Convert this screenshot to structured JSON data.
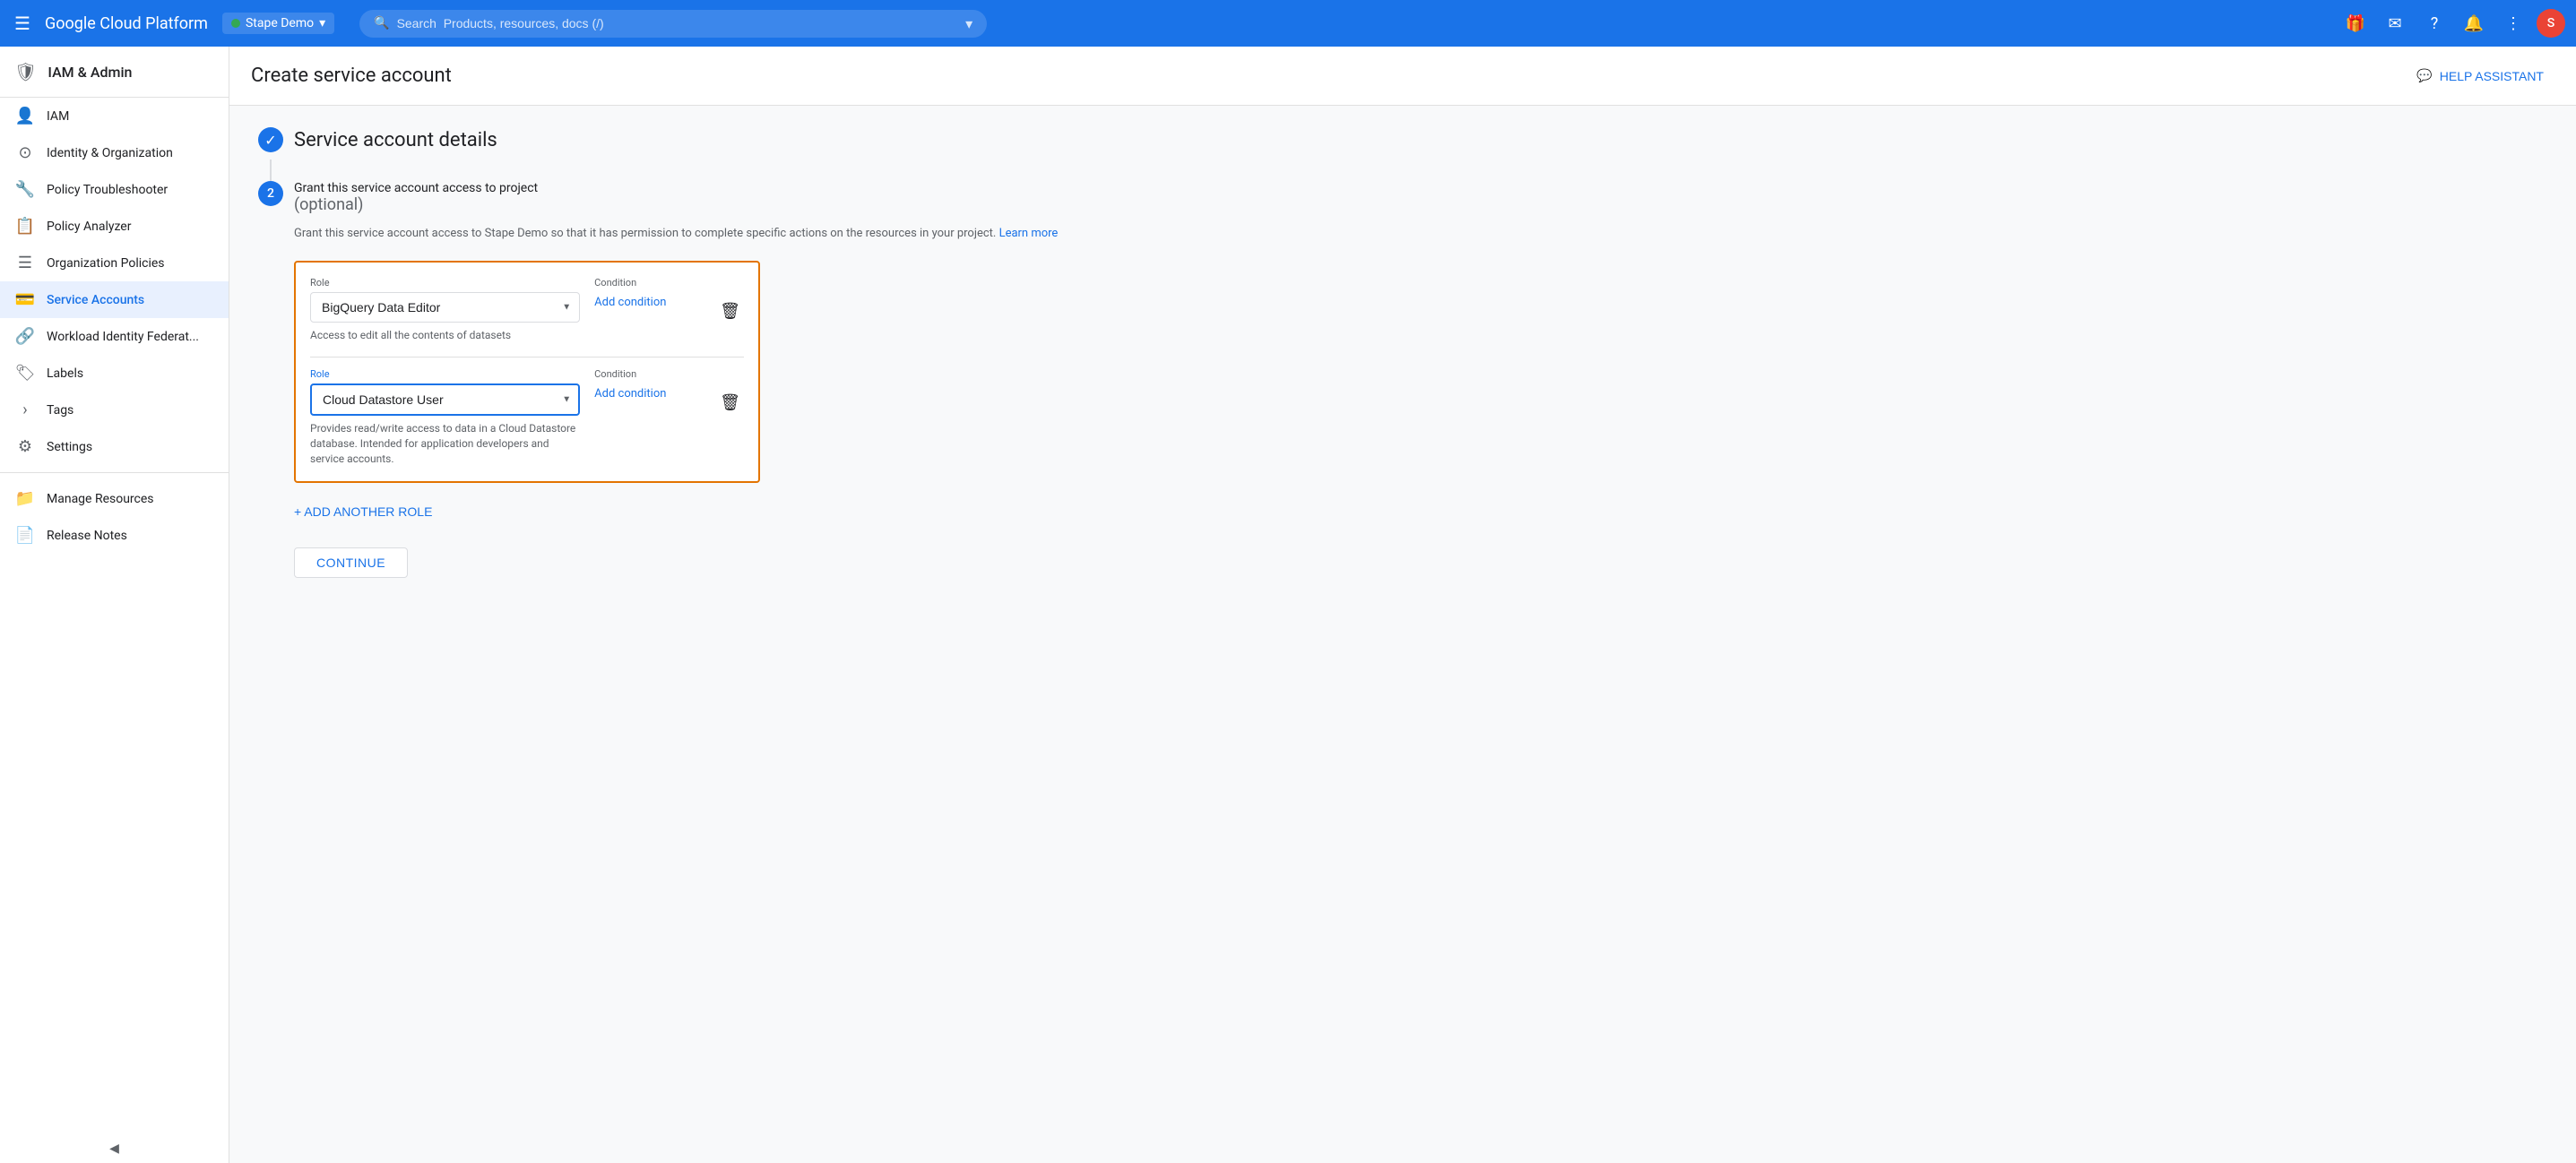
{
  "topNav": {
    "logoText": "Google Cloud Platform",
    "projectName": "Stape Demo",
    "searchPlaceholder": "Search  Products, resources, docs (/)",
    "avatarInitial": "S",
    "helpAssistantLabel": "HELP ASSISTANT"
  },
  "sidebar": {
    "headerTitle": "IAM & Admin",
    "items": [
      {
        "id": "iam",
        "label": "IAM",
        "icon": "👤"
      },
      {
        "id": "identity-org",
        "label": "Identity & Organization",
        "icon": "⊙"
      },
      {
        "id": "policy-troubleshooter",
        "label": "Policy Troubleshooter",
        "icon": "🔧"
      },
      {
        "id": "policy-analyzer",
        "label": "Policy Analyzer",
        "icon": "📋"
      },
      {
        "id": "org-policies",
        "label": "Organization Policies",
        "icon": "☰"
      },
      {
        "id": "service-accounts",
        "label": "Service Accounts",
        "icon": "💳",
        "active": true
      },
      {
        "id": "workload-identity",
        "label": "Workload Identity Federat...",
        "icon": "🔗"
      },
      {
        "id": "labels",
        "label": "Labels",
        "icon": "🏷"
      },
      {
        "id": "tags",
        "label": "Tags",
        "icon": "›"
      },
      {
        "id": "settings",
        "label": "Settings",
        "icon": "⚙"
      }
    ],
    "bottomItems": [
      {
        "id": "manage-resources",
        "label": "Manage Resources",
        "icon": "📁"
      },
      {
        "id": "release-notes",
        "label": "Release Notes",
        "icon": "📄"
      }
    ],
    "collapseLabel": "◀"
  },
  "page": {
    "title": "Create service account",
    "helpAssistantLabel": "HELP ASSISTANT"
  },
  "step1": {
    "title": "Service account details"
  },
  "step2": {
    "number": "2",
    "title": "Grant this service account access to project",
    "optional": "(optional)",
    "description": "Grant this service account access to Stape Demo so that it has permission to complete specific actions on the resources in your project.",
    "learnMoreLabel": "Learn more",
    "roles": [
      {
        "id": "role1",
        "roleLabel": "Role",
        "roleValue": "BigQuery Data Editor",
        "conditionLabel": "Condition",
        "addConditionLabel": "Add condition",
        "description": "Access to edit all the contents of datasets"
      },
      {
        "id": "role2",
        "roleLabel": "Role",
        "roleValue": "Cloud Datastore User",
        "conditionLabel": "Condition",
        "addConditionLabel": "Add condition",
        "description": "Provides read/write access to data in a Cloud Datastore database. Intended for application developers and service accounts.",
        "focused": true
      }
    ],
    "addRoleLabel": "+ ADD ANOTHER ROLE",
    "continueLabel": "CONTINUE"
  }
}
